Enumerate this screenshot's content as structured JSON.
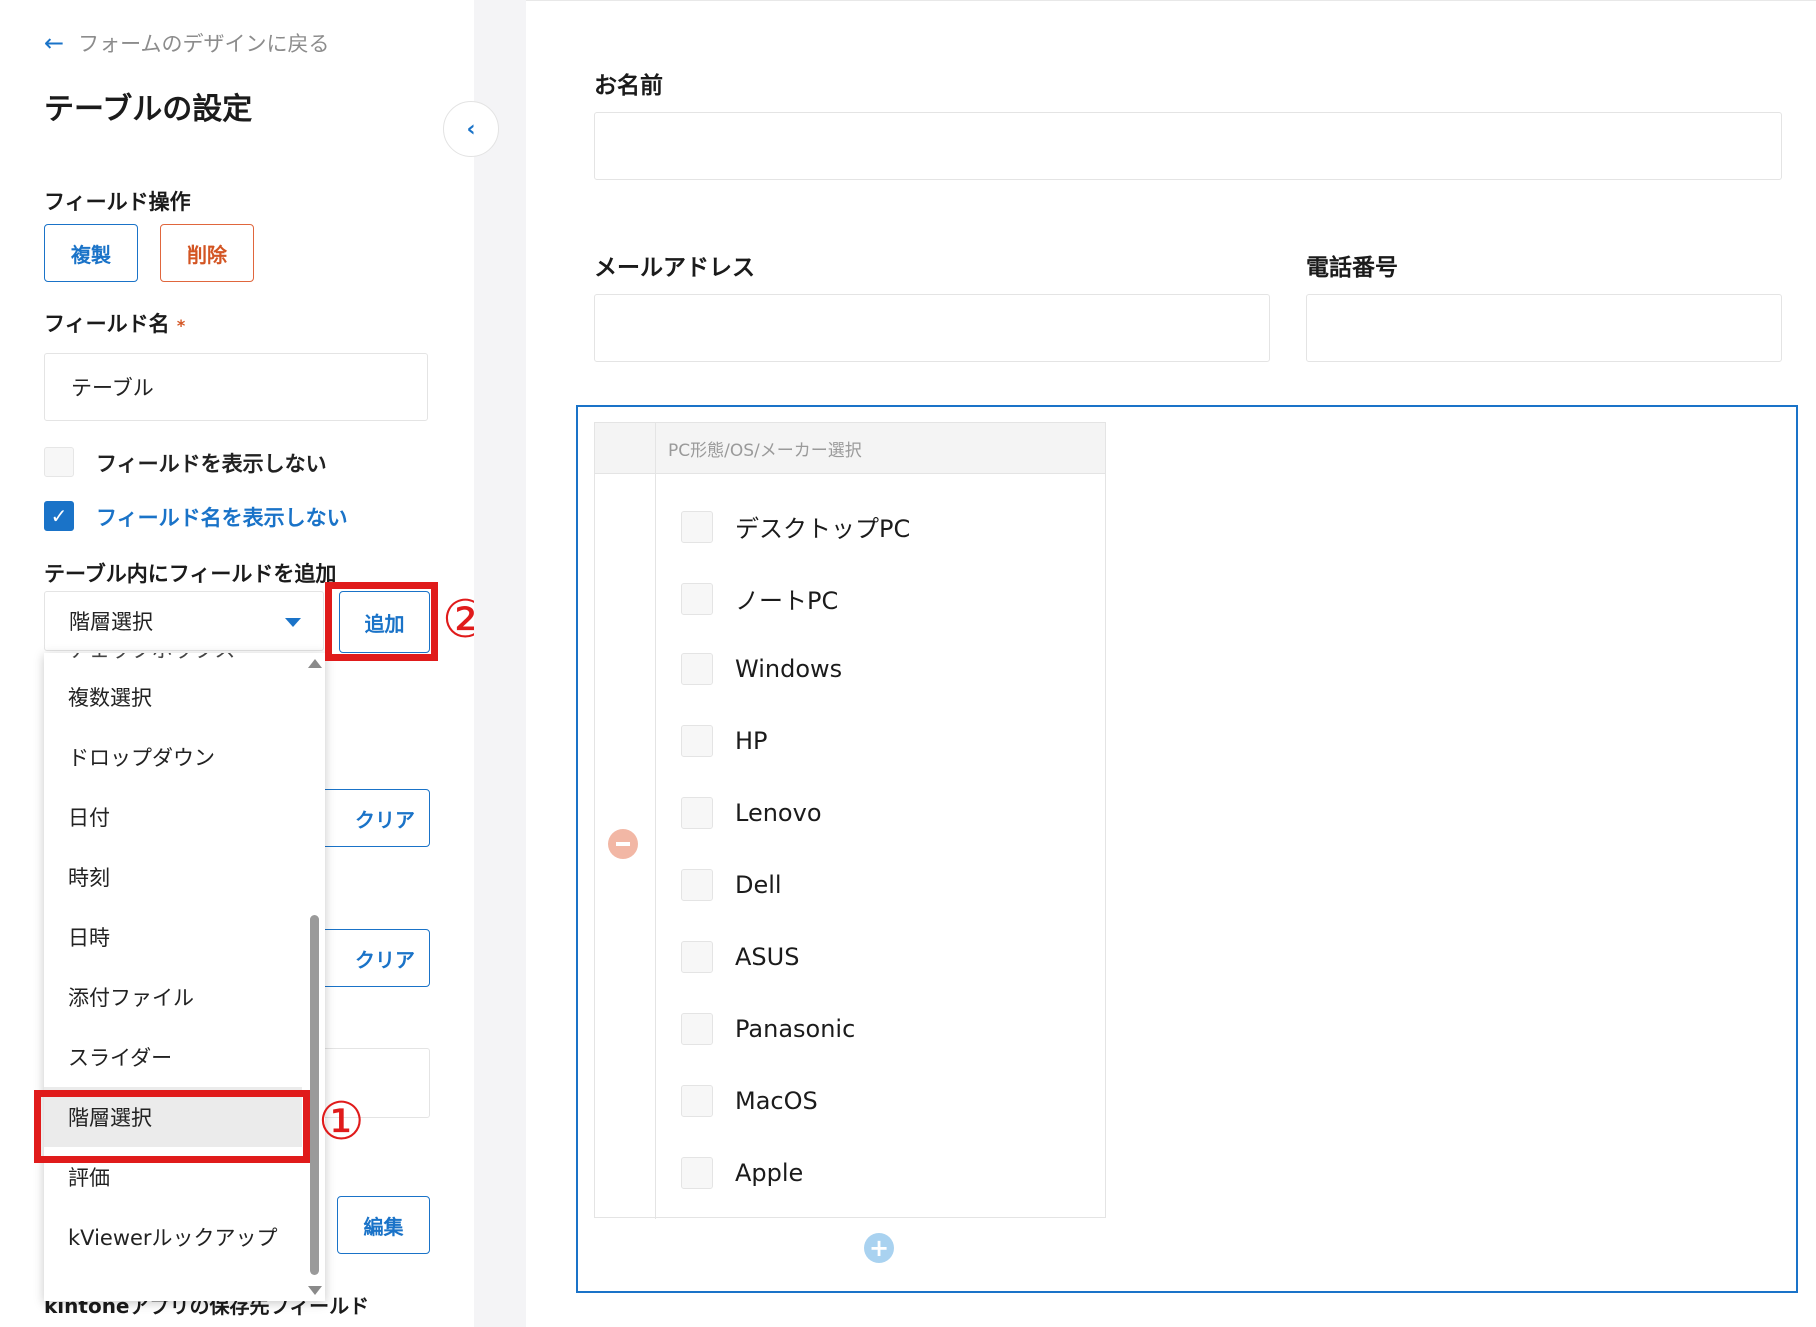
{
  "sidebar": {
    "back_label": "フォームのデザインに戻る",
    "title": "テーブルの設定",
    "field_ops_label": "フィールド操作",
    "duplicate_label": "複製",
    "delete_label": "削除",
    "field_name_label": "フィールド名",
    "required_mark": "*",
    "field_name_value": "テーブル",
    "hide_field_label": "フィールドを表示しない",
    "hide_field_checked": false,
    "hide_field_name_label": "フィールド名を表示しない",
    "hide_field_name_checked": true,
    "add_field_label": "テーブル内にフィールドを追加",
    "field_type_selected": "階層選択",
    "add_button_label": "追加",
    "clear_label_1": "クリア",
    "clear_label_2": "クリア",
    "edit_label": "編集",
    "kintone_label": "kintoneアプリの保存先フィールド",
    "dropdown_partial_item": "チェックボックス",
    "dropdown_items": [
      "複数選択",
      "ドロップダウン",
      "日付",
      "時刻",
      "日時",
      "添付ファイル",
      "スライダー",
      "階層選択",
      "評価",
      "kViewerルックアップ"
    ],
    "dropdown_selected_index": 7
  },
  "annotations": {
    "marker_1": "①",
    "marker_2": "②"
  },
  "form": {
    "name_label": "お名前",
    "email_label": "メールアドレス",
    "phone_label": "電話番号",
    "table_column_header": "PC形態/OS/メーカー選択",
    "options": [
      "デスクトップPC",
      "ノートPC",
      "Windows",
      "HP",
      "Lenovo",
      "Dell",
      "ASUS",
      "Panasonic",
      "MacOS",
      "Apple"
    ]
  },
  "colors": {
    "accent": "#1a73c8",
    "danger": "#d35523",
    "highlight": "#e01b1b"
  }
}
